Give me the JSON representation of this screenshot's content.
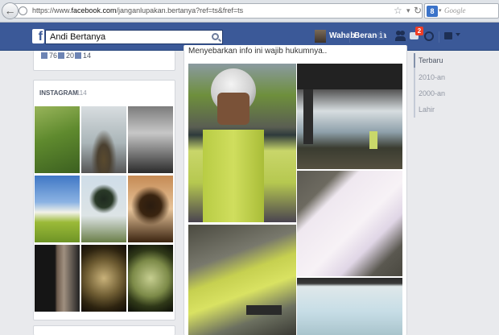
{
  "browser": {
    "url_prefix": "https://www.",
    "url_domain": "facebook.com",
    "url_path": "/janganlupakan.bertanya?ref=ts&fref=ts",
    "search_placeholder": "Google",
    "search_engine_letter": "8"
  },
  "fb": {
    "logo": "f",
    "search_value": "Andi Bertanya",
    "user_name": "Wahab",
    "home_label": "Beranda",
    "home_count": "1",
    "message_badge": "2"
  },
  "left": {
    "stats": [
      {
        "icon": "like-icon",
        "value": "76"
      },
      {
        "icon": "comment-icon",
        "value": "20"
      },
      {
        "icon": "share-icon",
        "value": "14"
      }
    ],
    "instagram_title": "INSTAGRAM",
    "instagram_count": "· 114"
  },
  "middle": {
    "caption": "Menyebarkan info ini wajib hukumnya.."
  },
  "timeline": {
    "items": [
      "Terbaru",
      "2010-an",
      "2000-an",
      "Lahir"
    ]
  },
  "colors": {
    "fb_blue": "#3b5998",
    "page_bg": "#e9eaed",
    "badge_red": "#f03d25"
  }
}
